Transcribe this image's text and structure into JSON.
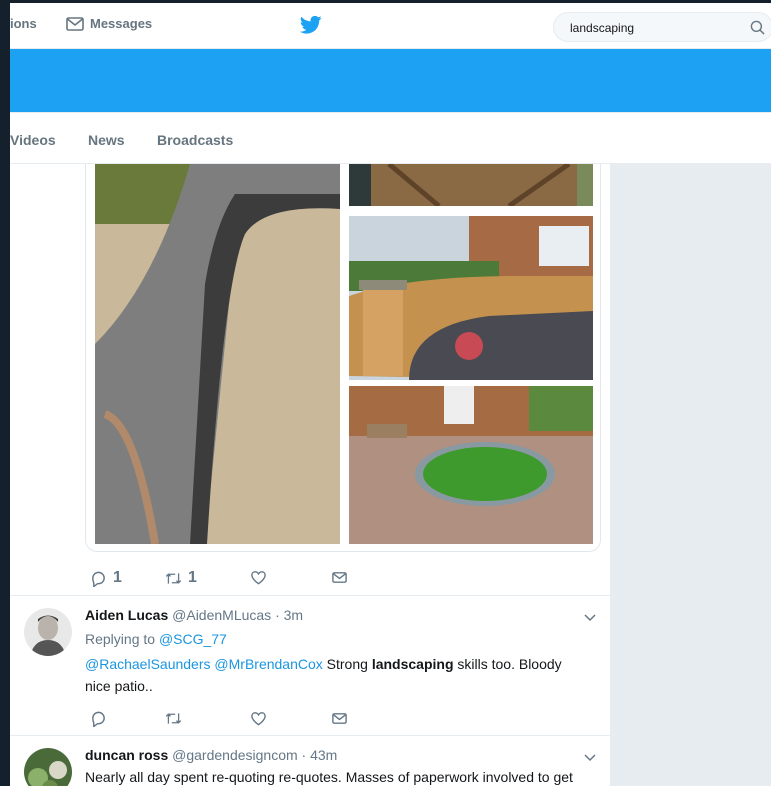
{
  "nav": {
    "notifications_label": "ions",
    "messages_label": "Messages",
    "search_value": "landscaping"
  },
  "tabs": [
    {
      "label": "Videos"
    },
    {
      "label": "News"
    },
    {
      "label": "Broadcasts"
    }
  ],
  "media_tweet": {
    "reply_count": "1",
    "retweet_count": "1"
  },
  "tweets": [
    {
      "name": "Aiden Lucas",
      "handle": "@AidenMLucas · 3m",
      "replying_prefix": "Replying to ",
      "replying_to": "@SCG_77",
      "mention1": "@RachaelSaunders",
      "mention2": "@MrBrendanCox",
      "text_pre": " Strong ",
      "keyword": "landscaping",
      "text_post": " skills too. Bloody nice patio.."
    },
    {
      "name": "duncan ross",
      "handle": "@gardendesigncom · 43m",
      "text": "Nearly all day spent re-quoting re-quotes. Masses of paperwork involved to get"
    }
  ],
  "colors": {
    "accent": "#1da1f2",
    "link": "#1b95e0",
    "frame": "#14202b"
  },
  "icons": [
    "mail-icon",
    "twitter-bird-icon",
    "search-icon",
    "reply-icon",
    "retweet-icon",
    "like-icon",
    "dm-icon",
    "chevron-down-icon"
  ]
}
